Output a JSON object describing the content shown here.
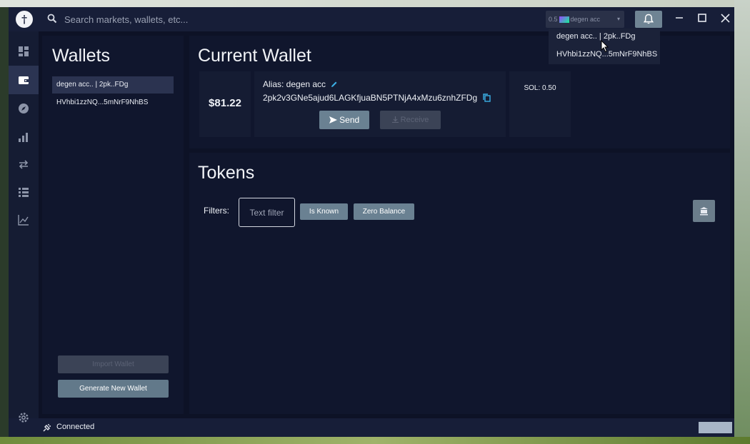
{
  "header": {
    "search_placeholder": "Search markets, wallets, etc...",
    "selected_wallet_prefix": "0.5",
    "selected_wallet_label": "degen acc",
    "caret": "▾"
  },
  "dropdown": {
    "items": [
      "degen acc.. | 2pk..FDg",
      "HVhbi1zzNQ...5mNrF9NhBS"
    ]
  },
  "nav": {
    "icons": [
      "dashboard-icon",
      "wallet-icon",
      "explore-icon",
      "bar-chart-icon",
      "swap-icon",
      "list-icon",
      "line-chart-icon"
    ],
    "active_index": 1
  },
  "wallets": {
    "title": "Wallets",
    "items": [
      "degen acc.. | 2pk..FDg",
      "HVhbi1zzNQ...5mNrF9NhBS"
    ],
    "import_label": "Import Wallet",
    "generate_label": "Generate New Wallet"
  },
  "current_wallet": {
    "title": "Current Wallet",
    "balance": "$81.22",
    "alias": "Alias: degen acc",
    "address": "2pk2v3GNe5ajud6LAGKfjuaBN5PTNjA4xMzu6znhZFDg",
    "send_label": "Send",
    "receive_label": "Receive",
    "sol_balance": "SOL: 0.50"
  },
  "tokens": {
    "title": "Tokens",
    "filters_label": "Filters:",
    "text_filter_placeholder": "Text filter",
    "chips": [
      "Is Known",
      "Zero Balance"
    ]
  },
  "status": {
    "connection": "Connected"
  },
  "colors": {
    "background": "#0d1226",
    "panel": "#10162d",
    "accent_button": "#6a8192",
    "disabled_button": "#3b4356"
  }
}
